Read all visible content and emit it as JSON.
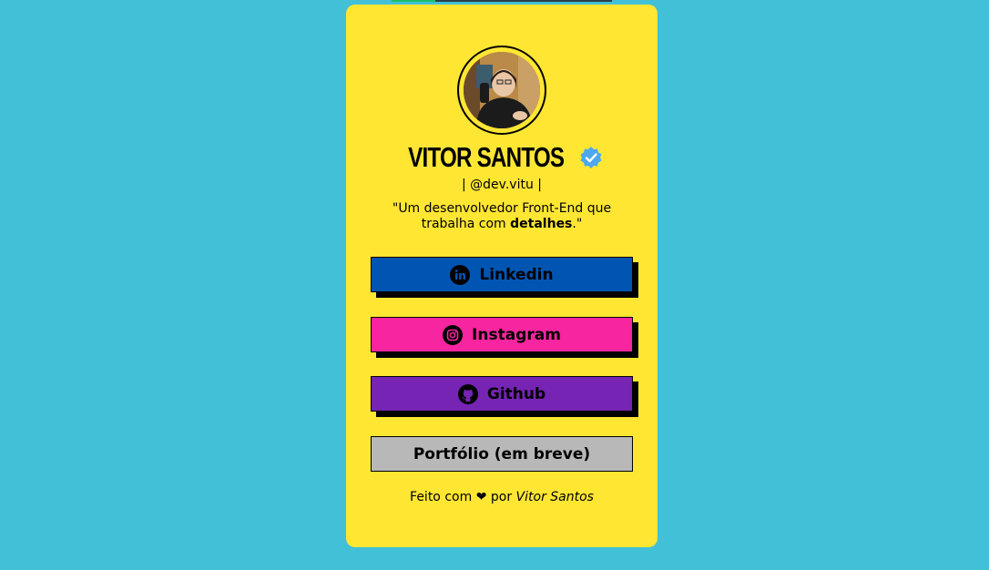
{
  "profile": {
    "name": "VITOR SANTOS",
    "handle": "| @dev.vitu |",
    "bio_part1": "\"Um desenvolvedor Front-End que trabalha com ",
    "bio_bold": "detalhes",
    "bio_part2": ".\""
  },
  "links": {
    "linkedin": {
      "label": "Linkedin",
      "color": "#0055b3",
      "icon": "linkedin-icon"
    },
    "instagram": {
      "label": "Instagram",
      "color": "#f7259f",
      "icon": "instagram-icon"
    },
    "github": {
      "label": "Github",
      "color": "#7524b3",
      "icon": "github-icon"
    },
    "portfolio": {
      "label": "Portfólio (em breve)",
      "color": "#b8b8b8"
    }
  },
  "footer": {
    "prefix": "Feito com",
    "heart": "❤",
    "middle": "por",
    "author": "Vitor Santos"
  },
  "colors": {
    "background": "#42c0d8",
    "card": "#ffe633",
    "verified": "#4da8ee"
  },
  "loading_progress": 0.2
}
